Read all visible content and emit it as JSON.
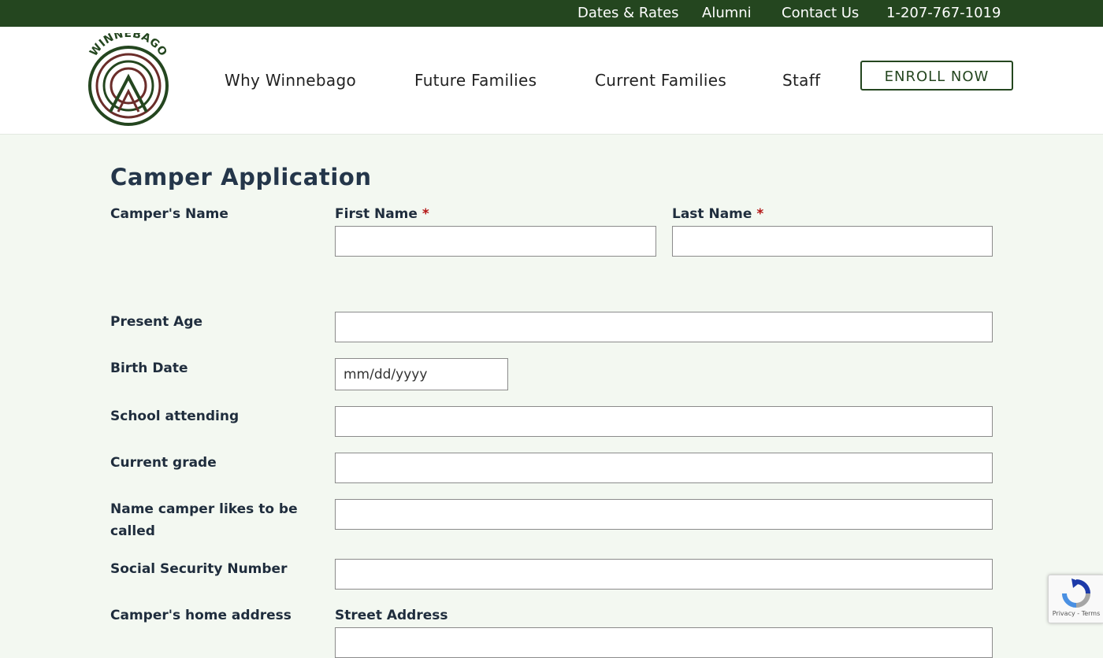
{
  "topbar": {
    "links": [
      "Dates & Rates",
      "Alumni",
      "Contact Us",
      "1-207-767-1019"
    ]
  },
  "header": {
    "logo_text": "WINNEBAGO",
    "nav": [
      "Why Winnebago",
      "Future Families",
      "Current Families",
      "Staff"
    ],
    "enroll_label": "ENROLL NOW"
  },
  "form": {
    "title": "Camper Application",
    "required_mark": "*",
    "campers_name_label": "Camper's Name",
    "first_name_label": "First Name",
    "last_name_label": "Last Name",
    "present_age_label": "Present Age",
    "birth_date_label": "Birth Date",
    "birth_date_placeholder": "mm/dd/yyyy",
    "school_label": "School attending",
    "grade_label": "Current grade",
    "nickname_label": "Name camper likes to be called",
    "ssn_label": "Social Security Number",
    "home_address_label": "Camper's home address",
    "street_address_label": "Street Address"
  },
  "recaptcha": {
    "privacy": "Privacy",
    "terms": "Terms"
  },
  "colors": {
    "brand_green": "#24461f",
    "page_bg": "#f3f8f1",
    "required_red": "#b41515"
  }
}
